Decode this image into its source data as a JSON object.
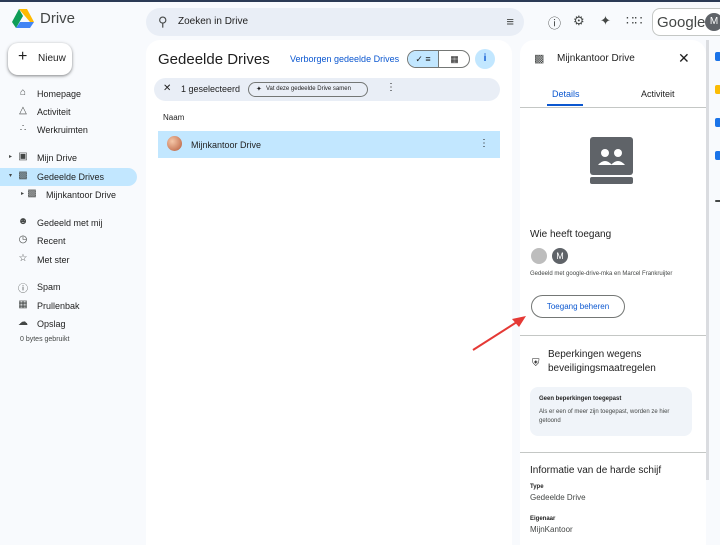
{
  "header": {
    "brand": "Drive",
    "search_placeholder": "Zoeken in Drive",
    "google_word": "Google",
    "account_initial": "M"
  },
  "sidebar": {
    "new_label": "Nieuw",
    "items": [
      {
        "label": "Homepage"
      },
      {
        "label": "Activiteit"
      },
      {
        "label": "Werkruimten"
      },
      {
        "label": "Mijn Drive"
      },
      {
        "label": "Gedeelde Drives"
      },
      {
        "label": "Mijnkantoor Drive"
      },
      {
        "label": "Gedeeld met mij"
      },
      {
        "label": "Recent"
      },
      {
        "label": "Met ster"
      },
      {
        "label": "Spam"
      },
      {
        "label": "Prullenbak"
      },
      {
        "label": "Opslag"
      }
    ],
    "storage_used": "0 bytes gebruikt"
  },
  "main": {
    "title": "Gedeelde Drives",
    "hidden_link": "Verborgen gedeelde Drives",
    "selection_count": "1 geselecteerd",
    "summarize_chip": "Vat deze gedeelde Drive samen",
    "column_name": "Naam",
    "rows": [
      {
        "name": "Mijnkantoor Drive"
      }
    ]
  },
  "panel": {
    "title": "Mijnkantoor Drive",
    "tab_details": "Details",
    "tab_activity": "Activiteit",
    "access_heading": "Wie heeft toegang",
    "access_avatar_initial": "M",
    "shared_text": "Gedeeld met google-drive-mka en Marcel Frankruijter",
    "manage_access": "Toegang beheren",
    "restrictions_heading": "Beperkingen wegens beveiligingsmaatregelen",
    "restrictions_box_title": "Geen beperkingen toegepast",
    "restrictions_box_text": "Als er een of meer zijn toegepast, worden ze hier getoond",
    "disk_info_heading": "Informatie van de harde schijf",
    "type_label": "Type",
    "type_value": "Gedeelde Drive",
    "owner_label": "Eigenaar",
    "owner_value": "MijnKantoor"
  },
  "colors": {
    "accent_blue": "#0b57d0",
    "selection_blue": "#c2e7ff",
    "annotation_arrow": "#e53935"
  },
  "icons": [
    "drive-logo-icon",
    "search-icon",
    "filter-icon",
    "help-icon",
    "settings-icon",
    "gemini-icon",
    "apps-icon",
    "plus-icon",
    "home-icon",
    "bell-icon",
    "workspaces-icon",
    "my-drive-icon",
    "shared-drives-icon",
    "people-icon",
    "clock-icon",
    "star-icon",
    "spam-icon",
    "trash-icon",
    "cloud-icon",
    "close-icon",
    "sparkle-icon",
    "more-vert-icon",
    "list-view-icon",
    "grid-view-icon",
    "info-icon",
    "shield-icon"
  ]
}
